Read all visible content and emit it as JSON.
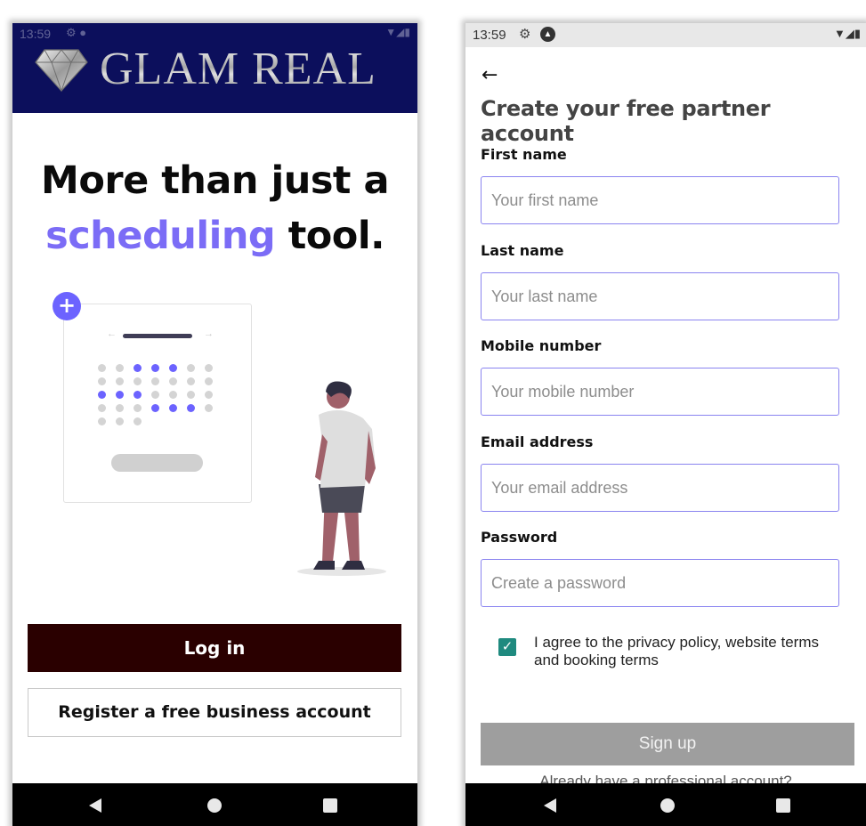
{
  "left_screen": {
    "status_bar": {
      "time": "13:59"
    },
    "brand": {
      "name": "GLAM REAL",
      "bar_color": "#0c0f5c"
    },
    "headline": {
      "line1": "More than just a",
      "accent": "scheduling",
      "tail": " tool."
    },
    "illustration": {
      "plus_label": "+"
    },
    "buttons": {
      "login": "Log in",
      "register": "Register a free business account"
    }
  },
  "right_screen": {
    "status_bar": {
      "time": "13:59"
    },
    "title": "Create your free partner account",
    "fields": [
      {
        "label": "First name",
        "placeholder": "Your first name"
      },
      {
        "label": "Last name",
        "placeholder": "Your last name"
      },
      {
        "label": "Mobile number",
        "placeholder": "Your mobile number"
      },
      {
        "label": "Email address",
        "placeholder": "Your email address"
      },
      {
        "label": "Password",
        "placeholder": "Create a password"
      }
    ],
    "agreement": {
      "checked": true,
      "text": "I agree to the privacy policy, website terms and booking terms"
    },
    "signup_button": "Sign up",
    "footer_link": "Already have a professional account?"
  },
  "colors": {
    "accent": "#7b6cf6",
    "login_button": "#2a0000",
    "input_border": "#8a84f0",
    "checkbox": "#1f8a7f",
    "signup_disabled": "#9e9e9e"
  }
}
